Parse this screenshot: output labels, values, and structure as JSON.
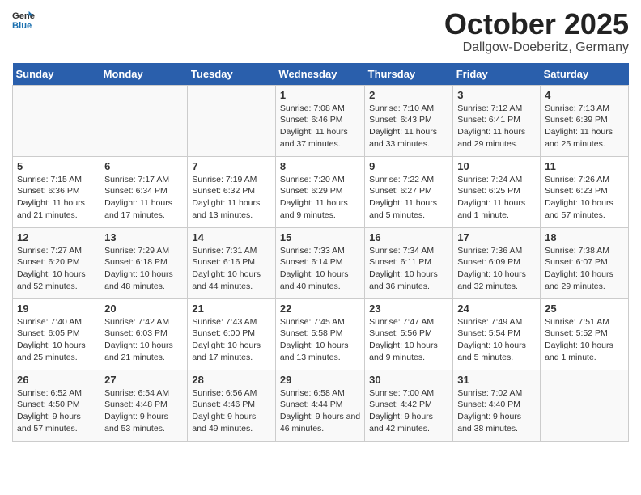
{
  "header": {
    "logo_general": "General",
    "logo_blue": "Blue",
    "month": "October 2025",
    "location": "Dallgow-Doeberitz, Germany"
  },
  "weekdays": [
    "Sunday",
    "Monday",
    "Tuesday",
    "Wednesday",
    "Thursday",
    "Friday",
    "Saturday"
  ],
  "weeks": [
    [
      {
        "day": "",
        "info": ""
      },
      {
        "day": "",
        "info": ""
      },
      {
        "day": "",
        "info": ""
      },
      {
        "day": "1",
        "info": "Sunrise: 7:08 AM\nSunset: 6:46 PM\nDaylight: 11 hours and 37 minutes."
      },
      {
        "day": "2",
        "info": "Sunrise: 7:10 AM\nSunset: 6:43 PM\nDaylight: 11 hours and 33 minutes."
      },
      {
        "day": "3",
        "info": "Sunrise: 7:12 AM\nSunset: 6:41 PM\nDaylight: 11 hours and 29 minutes."
      },
      {
        "day": "4",
        "info": "Sunrise: 7:13 AM\nSunset: 6:39 PM\nDaylight: 11 hours and 25 minutes."
      }
    ],
    [
      {
        "day": "5",
        "info": "Sunrise: 7:15 AM\nSunset: 6:36 PM\nDaylight: 11 hours and 21 minutes."
      },
      {
        "day": "6",
        "info": "Sunrise: 7:17 AM\nSunset: 6:34 PM\nDaylight: 11 hours and 17 minutes."
      },
      {
        "day": "7",
        "info": "Sunrise: 7:19 AM\nSunset: 6:32 PM\nDaylight: 11 hours and 13 minutes."
      },
      {
        "day": "8",
        "info": "Sunrise: 7:20 AM\nSunset: 6:29 PM\nDaylight: 11 hours and 9 minutes."
      },
      {
        "day": "9",
        "info": "Sunrise: 7:22 AM\nSunset: 6:27 PM\nDaylight: 11 hours and 5 minutes."
      },
      {
        "day": "10",
        "info": "Sunrise: 7:24 AM\nSunset: 6:25 PM\nDaylight: 11 hours and 1 minute."
      },
      {
        "day": "11",
        "info": "Sunrise: 7:26 AM\nSunset: 6:23 PM\nDaylight: 10 hours and 57 minutes."
      }
    ],
    [
      {
        "day": "12",
        "info": "Sunrise: 7:27 AM\nSunset: 6:20 PM\nDaylight: 10 hours and 52 minutes."
      },
      {
        "day": "13",
        "info": "Sunrise: 7:29 AM\nSunset: 6:18 PM\nDaylight: 10 hours and 48 minutes."
      },
      {
        "day": "14",
        "info": "Sunrise: 7:31 AM\nSunset: 6:16 PM\nDaylight: 10 hours and 44 minutes."
      },
      {
        "day": "15",
        "info": "Sunrise: 7:33 AM\nSunset: 6:14 PM\nDaylight: 10 hours and 40 minutes."
      },
      {
        "day": "16",
        "info": "Sunrise: 7:34 AM\nSunset: 6:11 PM\nDaylight: 10 hours and 36 minutes."
      },
      {
        "day": "17",
        "info": "Sunrise: 7:36 AM\nSunset: 6:09 PM\nDaylight: 10 hours and 32 minutes."
      },
      {
        "day": "18",
        "info": "Sunrise: 7:38 AM\nSunset: 6:07 PM\nDaylight: 10 hours and 29 minutes."
      }
    ],
    [
      {
        "day": "19",
        "info": "Sunrise: 7:40 AM\nSunset: 6:05 PM\nDaylight: 10 hours and 25 minutes."
      },
      {
        "day": "20",
        "info": "Sunrise: 7:42 AM\nSunset: 6:03 PM\nDaylight: 10 hours and 21 minutes."
      },
      {
        "day": "21",
        "info": "Sunrise: 7:43 AM\nSunset: 6:00 PM\nDaylight: 10 hours and 17 minutes."
      },
      {
        "day": "22",
        "info": "Sunrise: 7:45 AM\nSunset: 5:58 PM\nDaylight: 10 hours and 13 minutes."
      },
      {
        "day": "23",
        "info": "Sunrise: 7:47 AM\nSunset: 5:56 PM\nDaylight: 10 hours and 9 minutes."
      },
      {
        "day": "24",
        "info": "Sunrise: 7:49 AM\nSunset: 5:54 PM\nDaylight: 10 hours and 5 minutes."
      },
      {
        "day": "25",
        "info": "Sunrise: 7:51 AM\nSunset: 5:52 PM\nDaylight: 10 hours and 1 minute."
      }
    ],
    [
      {
        "day": "26",
        "info": "Sunrise: 6:52 AM\nSunset: 4:50 PM\nDaylight: 9 hours and 57 minutes."
      },
      {
        "day": "27",
        "info": "Sunrise: 6:54 AM\nSunset: 4:48 PM\nDaylight: 9 hours and 53 minutes."
      },
      {
        "day": "28",
        "info": "Sunrise: 6:56 AM\nSunset: 4:46 PM\nDaylight: 9 hours and 49 minutes."
      },
      {
        "day": "29",
        "info": "Sunrise: 6:58 AM\nSunset: 4:44 PM\nDaylight: 9 hours and 46 minutes."
      },
      {
        "day": "30",
        "info": "Sunrise: 7:00 AM\nSunset: 4:42 PM\nDaylight: 9 hours and 42 minutes."
      },
      {
        "day": "31",
        "info": "Sunrise: 7:02 AM\nSunset: 4:40 PM\nDaylight: 9 hours and 38 minutes."
      },
      {
        "day": "",
        "info": ""
      }
    ]
  ]
}
